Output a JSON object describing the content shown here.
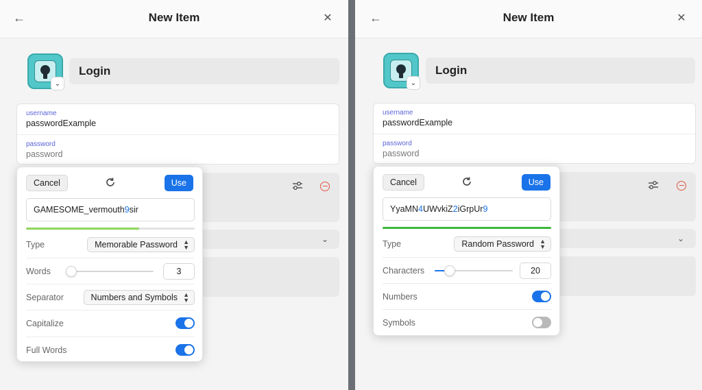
{
  "left": {
    "header": {
      "title": "New Item",
      "back_icon": "arrow-left-icon",
      "close_icon": "close-icon"
    },
    "item_type": "Login",
    "credentials": {
      "username_label": "username",
      "username_value": "passwordExample",
      "password_label": "password",
      "password_placeholder": "password"
    },
    "generator": {
      "cancel_label": "Cancel",
      "use_label": "Use",
      "password_parts": [
        "GAMESOME_vermouth",
        "9",
        "sir"
      ],
      "strength_fraction": 0.67,
      "strength_color": "#8fd45a",
      "type_label": "Type",
      "type_value": "Memorable Password",
      "words_label": "Words",
      "words_value": "3",
      "words_slider_fraction": 0.0,
      "separator_label": "Separator",
      "separator_value": "Numbers and Symbols",
      "capitalize_label": "Capitalize",
      "capitalize_on": true,
      "full_words_label": "Full Words",
      "full_words_on": true
    }
  },
  "right": {
    "header": {
      "title": "New Item",
      "back_icon": "arrow-left-icon",
      "close_icon": "close-icon"
    },
    "item_type": "Login",
    "credentials": {
      "username_label": "username",
      "username_value": "passwordExample",
      "password_label": "password",
      "password_placeholder": "password"
    },
    "generator": {
      "cancel_label": "Cancel",
      "use_label": "Use",
      "password_parts": [
        "YyaMN",
        "4",
        "UWvkiZ",
        "2",
        "iGrpUr",
        "9"
      ],
      "strength_fraction": 1.0,
      "strength_color": "#3cb83c",
      "type_label": "Type",
      "type_value": "Random Password",
      "characters_label": "Characters",
      "characters_value": "20",
      "characters_slider_fraction": 0.19,
      "numbers_label": "Numbers",
      "numbers_on": true,
      "symbols_label": "Symbols",
      "symbols_on": false
    }
  },
  "colors": {
    "accent": "#1a73e8",
    "label_purple": "#5a63d8",
    "danger": "#e05545"
  }
}
